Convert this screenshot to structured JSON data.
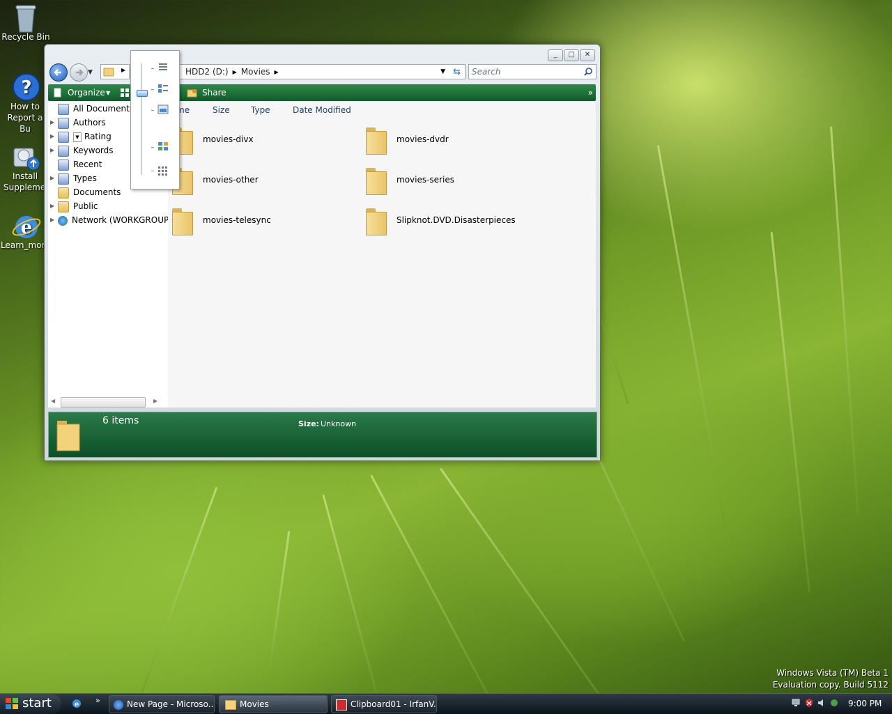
{
  "desktop": {
    "icons": [
      {
        "label": "Recycle Bin",
        "icon": "recycle-bin-icon"
      },
      {
        "label": "How to Report a Bu",
        "icon": "help-icon"
      },
      {
        "label": "Install Supplemen",
        "icon": "install-icon"
      },
      {
        "label": "Learn_more",
        "icon": "internet-explorer-icon"
      }
    ],
    "watermark": {
      "line1": "Windows Vista (TM) Beta 1",
      "line2": "Evaluation copy. Build 5112"
    }
  },
  "window": {
    "controls": {
      "minimize": "_",
      "maximize": "□",
      "close": "✕"
    },
    "address": {
      "crumb1": "HDD2 (D:)",
      "crumb2": "Movies"
    },
    "search": {
      "placeholder": "Search"
    },
    "toolbar": {
      "organize": "Organize",
      "share": "Share",
      "more": "»"
    },
    "nav": {
      "items": [
        {
          "label": "All Documents",
          "icon": "saved-search-icon"
        },
        {
          "label": "Authors",
          "icon": "saved-search-icon"
        },
        {
          "label": "Rating",
          "icon": "saved-search-icon"
        },
        {
          "label": "Keywords",
          "icon": "saved-search-icon"
        },
        {
          "label": "Recent",
          "icon": "saved-search-icon"
        },
        {
          "label": "Types",
          "icon": "saved-search-icon"
        },
        {
          "label": "Documents",
          "icon": "folder-icon"
        },
        {
          "label": "Public",
          "icon": "folder-icon"
        },
        {
          "label": "Network (WORKGROUP",
          "icon": "network-icon"
        }
      ]
    },
    "columns": {
      "name": "me",
      "size": "Size",
      "type": "Type",
      "date": "Date Modified"
    },
    "folders": [
      "movies-divx",
      "movies-dvdr",
      "movies-other",
      "movies-series",
      "movies-telesync",
      "Slipknot.DVD.Disasterpieces"
    ],
    "status": {
      "count": "6 items",
      "size_label": "Size:",
      "size_value": "Unknown"
    }
  },
  "view_slider": {
    "icons": [
      "details-view-icon",
      "tiles-view-icon",
      "thumbnails-view-icon",
      "icons-view-icon",
      "list-view-icon"
    ]
  },
  "taskbar": {
    "start": "start",
    "more": "»",
    "tasks": [
      {
        "label": "New Page - Microso...",
        "icon": "internet-explorer-icon"
      },
      {
        "label": "Movies",
        "icon": "folder-icon"
      },
      {
        "label": "Clipboard01 - IrfanV...",
        "icon": "irfanview-icon"
      }
    ],
    "clock": "9:00 PM"
  }
}
